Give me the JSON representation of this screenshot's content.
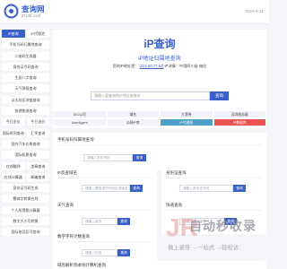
{
  "header": {
    "title": "查询网",
    "subtitle": "iP138.com",
    "date": "2023-6-21"
  },
  "sidebar": {
    "rows": [
      [
        {
          "label": "iP查询",
          "active": true
        },
        {
          "label": "iP代理池"
        }
      ],
      [
        {
          "label": "手机号码归属地查询"
        }
      ],
      [
        {
          "label": "二维码生成器"
        }
      ],
      [
        {
          "label": "身份证号码查询"
        }
      ],
      [
        {
          "label": "生辰八字查询"
        }
      ],
      [
        {
          "label": "天气预报查询"
        }
      ],
      [
        {
          "label": "以太坊区块链查询"
        }
      ],
      [
        {
          "label": "快递物流查询"
        }
      ],
      [
        {
          "label": "今日金价"
        },
        {
          "label": "今日油价"
        }
      ],
      [
        {
          "label": "国际时间查询"
        },
        {
          "label": "汇率查询"
        }
      ],
      [
        {
          "label": "国内汽车价格查询"
        }
      ],
      [
        {
          "label": "国际机票查询"
        }
      ],
      [
        {
          "label": "在线翻译"
        },
        {
          "label": "违章查询"
        }
      ],
      [
        {
          "label": "在线计算器"
        },
        {
          "label": "邮编查询"
        }
      ],
      [
        {
          "label": "身份证号码生成"
        }
      ],
      [
        {
          "label": "繁体字转换在线"
        }
      ],
      [
        {
          "label": "个人所得税计算器"
        }
      ],
      [
        {
          "label": "数字大小写转换"
        }
      ],
      [
        {
          "label": "国际电话区号查询"
        }
      ]
    ]
  },
  "hero": {
    "title": "iP查询",
    "subtitle": "iP地址归属地查询",
    "ip_prefix": "您的iP地址是：",
    "ip_value": "[222.60.77.62]",
    "ip_suffix": "iP详情：中国四川省 电信",
    "search_placeholder": "请输入要查询的iP地址或域名",
    "search_button": "查询"
  },
  "tags": [
    [
      {
        "label": "iDC公司",
        "style": "normal"
      },
      {
        "label": "域名",
        "style": "normal"
      },
      {
        "label": "大宽带",
        "style": "normal"
      },
      {
        "label": "深圳服务器",
        "style": "normal"
      }
    ],
    [
      {
        "label": "UserAgent",
        "style": "normal"
      },
      {
        "label": "公网iP库",
        "style": "normal"
      },
      {
        "label": "iP代理服",
        "style": "teal"
      },
      {
        "label": "iP数据库",
        "style": "hot"
      }
    ]
  ],
  "panels": {
    "phone": {
      "title": "手机号码归属地查询",
      "placeholder": "请输入手机号码",
      "button": "查询"
    },
    "ip_to_geo": {
      "title": "iP反查域名",
      "placeholder": "请输入要查询的iP地址或域名",
      "button": "查询"
    },
    "idcard": {
      "title": "身份证查询",
      "placeholder": "请输入身份证号码",
      "button": "查询"
    },
    "weather": {
      "title": "天气查询",
      "placeholder": "请输入城市",
      "button": "查询"
    },
    "express": {
      "title": "快递查询",
      "placeholder": "请输入快递单号",
      "button": "查询"
    },
    "zip": {
      "title": "数字字符计数查询",
      "placeholder": "请输入内容",
      "button": "查询"
    },
    "bottom": {
      "title": "域名解析到本地计算机查询"
    }
  },
  "watermark": {
    "logo": "JR",
    "brand": "自动秒收录",
    "slogan": "做上录排 →一站式 →轻松访"
  },
  "colors": {
    "accent": "#3a5fc8",
    "hot": "#e8534f",
    "teal": "#4aa0c9"
  }
}
